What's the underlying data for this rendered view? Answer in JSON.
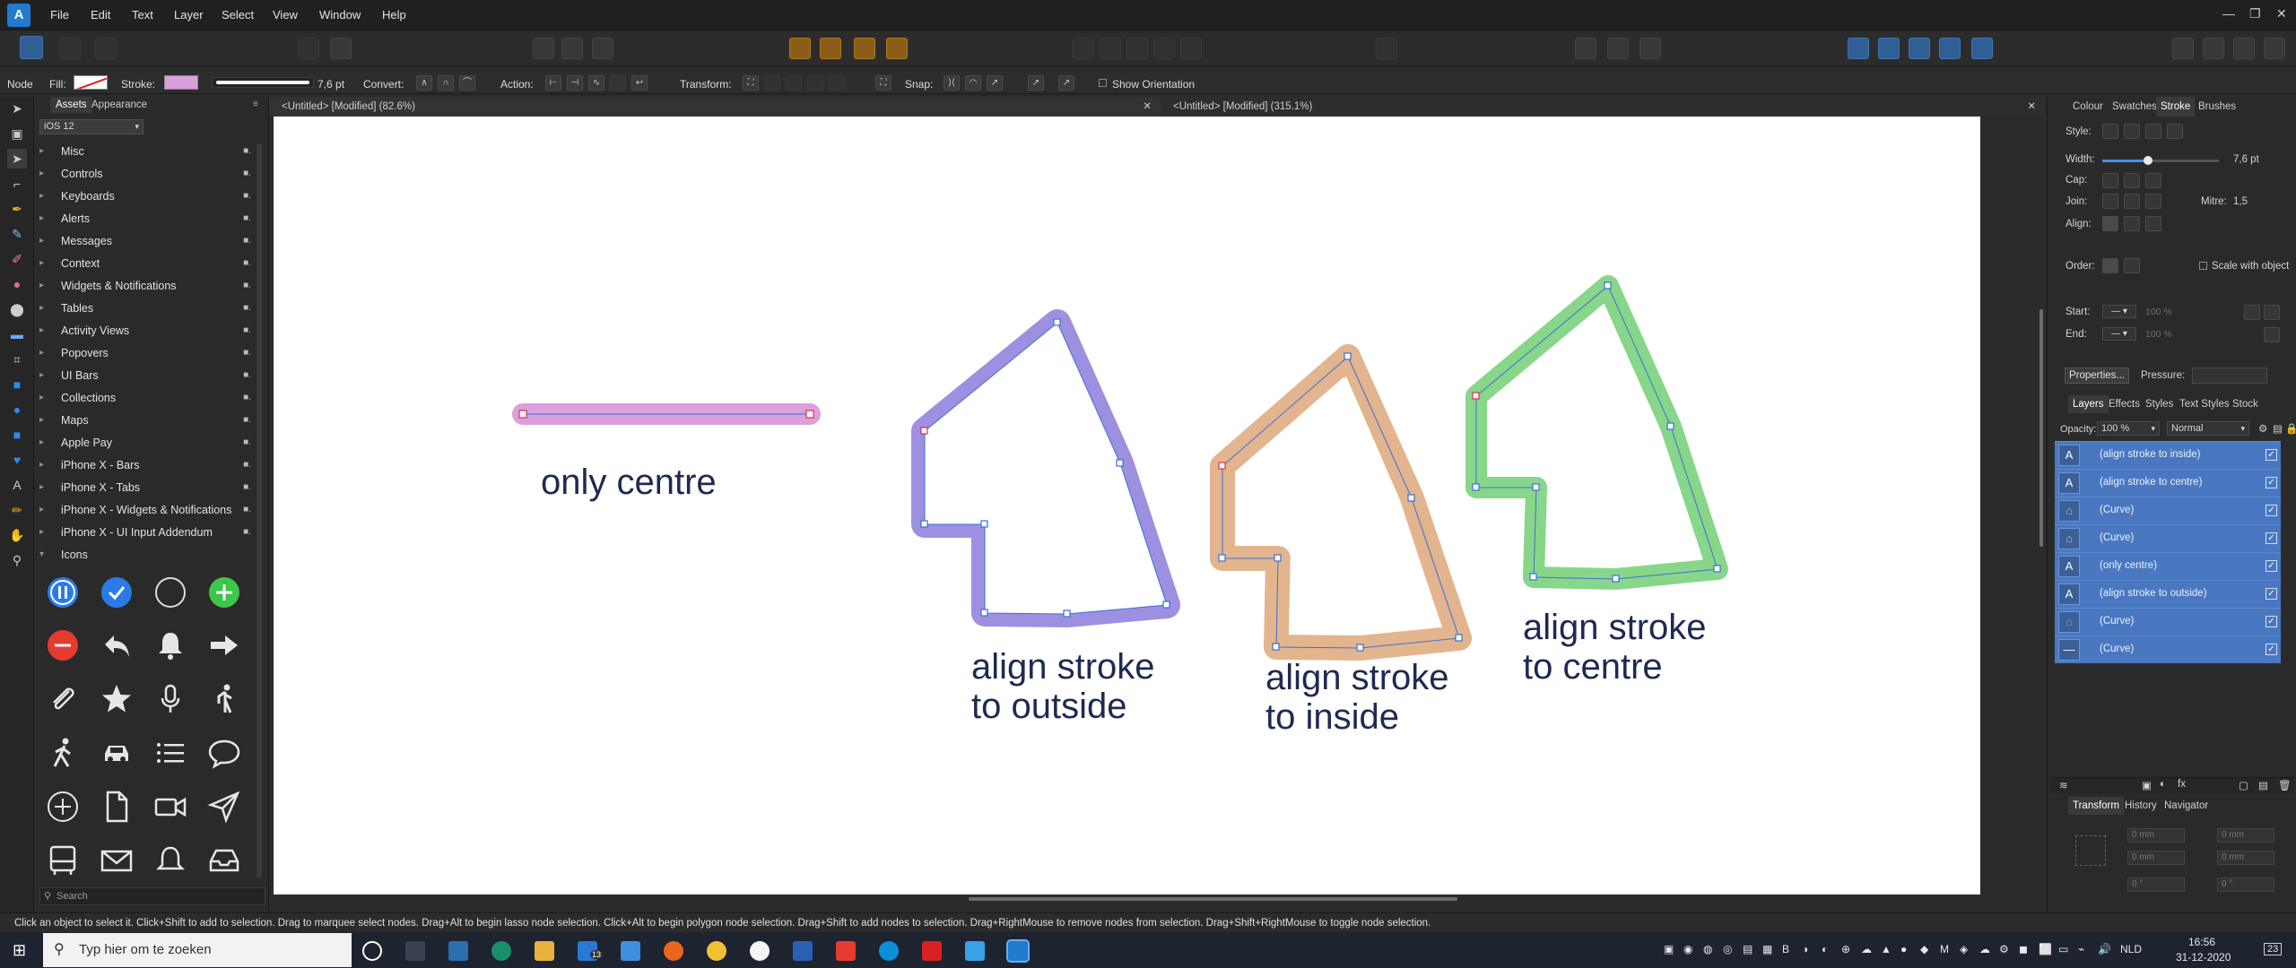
{
  "app": {
    "logo": "A",
    "logo_icon": "affinity-designer-icon"
  },
  "menu": [
    "File",
    "Edit",
    "Text",
    "Layer",
    "Select",
    "View",
    "Window",
    "Help"
  ],
  "context_toolbar": {
    "mode": "Node",
    "fill_label": "Fill:",
    "stroke_label": "Stroke:",
    "stroke_width": "7,6 pt",
    "convert_label": "Convert:",
    "action_label": "Action:",
    "transform_label": "Transform:",
    "snap_label": "Snap:",
    "show_orientation": "Show Orientation",
    "stroke_color": "#d9a0dc"
  },
  "assets_panel": {
    "tabs": [
      "Assets",
      "Appearance"
    ],
    "category": "iOS 12",
    "items": [
      "Misc",
      "Controls",
      "Keyboards",
      "Alerts",
      "Messages",
      "Context",
      "Widgets & Notifications",
      "Tables",
      "Activity Views",
      "Popovers",
      "UI Bars",
      "Collections",
      "Maps",
      "Apple Pay",
      "iPhone X - Bars",
      "iPhone X - Tabs",
      "iPhone X - Widgets & Notifications",
      "iPhone X - UI Input Addendum",
      "Icons"
    ],
    "search_placeholder": "Search"
  },
  "documents": [
    {
      "title": "<Untitled> [Modified] (82.6%)"
    },
    {
      "title": "<Untitled> [Modified] (315.1%)"
    }
  ],
  "canvas": {
    "labels": [
      "only centre",
      "align stroke\nto outside",
      "align stroke\nto inside",
      "align stroke\nto centre"
    ]
  },
  "right_panel": {
    "tabs": [
      "Colour",
      "Swatches",
      "Stroke",
      "Brushes"
    ],
    "style_label": "Style:",
    "width_label": "Width:",
    "width_value": "7,6 pt",
    "cap_label": "Cap:",
    "join_label": "Join:",
    "mitre_label": "Mitre:",
    "mitre_value": "1,5",
    "align_label": "Align:",
    "order_label": "Order:",
    "scale_with_object": "Scale with object",
    "start_label": "Start:",
    "end_label": "End:",
    "start_pct": "100 %",
    "end_pct": "100 %",
    "properties_button": "Properties...",
    "pressure_label": "Pressure:",
    "layer_tabs": [
      "Layers",
      "Effects",
      "Styles",
      "Text Styles",
      "Stock"
    ],
    "opacity_label": "Opacity:",
    "opacity_value": "100 %",
    "blend_mode": "Normal",
    "layers": [
      {
        "name": "(align stroke to inside)",
        "kind": "text"
      },
      {
        "name": "(align stroke to centre)",
        "kind": "text"
      },
      {
        "name": "(Curve)",
        "kind": "curve-green"
      },
      {
        "name": "(Curve)",
        "kind": "curve-orange"
      },
      {
        "name": "(only centre)",
        "kind": "text"
      },
      {
        "name": "(align stroke to outside)",
        "kind": "text"
      },
      {
        "name": "(Curve)",
        "kind": "curve-purple"
      },
      {
        "name": "(Curve)",
        "kind": "line"
      }
    ],
    "bottom_tabs": [
      "Transform",
      "History",
      "Navigator"
    ],
    "transform_fields": [
      "0 mm",
      "0 mm",
      "0 mm",
      "0 mm",
      "0 °",
      "0 °"
    ]
  },
  "status_text": "Click an object to select it. Click+Shift to add to selection. Drag to marquee select nodes. Drag+Alt to begin lasso node selection. Click+Alt to begin polygon node selection. Drag+Shift to add nodes to selection. Drag+RightMouse to remove nodes from selection. Drag+Shift+RightMouse to toggle node selection.",
  "taskbar": {
    "search_placeholder": "Typ hier om te zoeken",
    "language": "NLD",
    "time": "16:56",
    "date": "31-12-2020",
    "notifications": "23",
    "mail_badge": "13"
  },
  "colors": {
    "purple_stroke": "#9d90e0",
    "orange_stroke": "#e2b58e",
    "green_stroke": "#88d68a",
    "pink_stroke": "#d9a0dc",
    "selection_blue": "#4a78c0"
  }
}
